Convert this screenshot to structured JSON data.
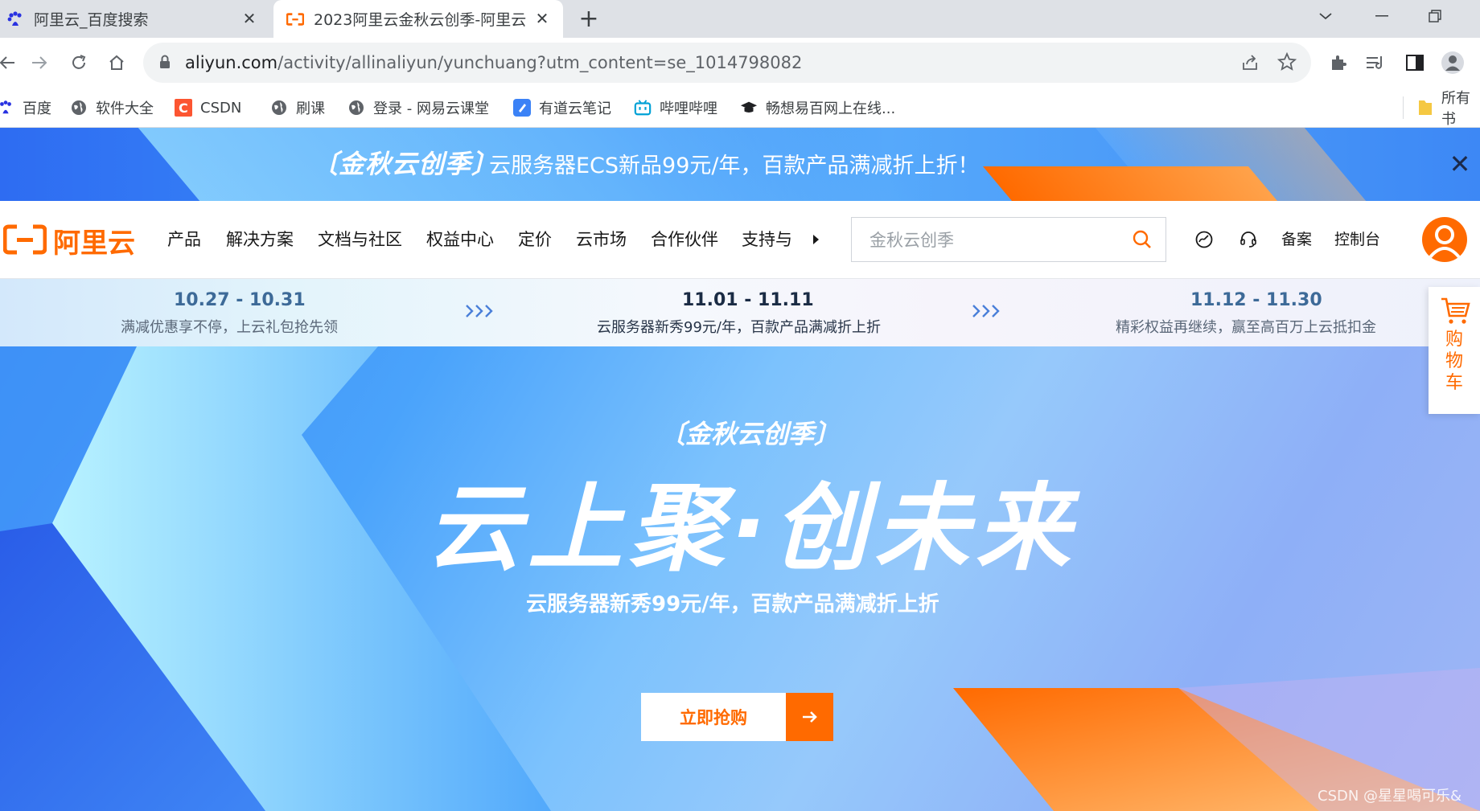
{
  "browser": {
    "tabs": [
      {
        "title": "阿里云_百度搜索",
        "favicon": "baidu-paw-icon",
        "active": false
      },
      {
        "title": "2023阿里云金秋云创季-阿里云",
        "favicon": "aliyun-logo-icon",
        "active": true
      }
    ],
    "new_tab_icon": "plus-icon",
    "window_buttons": [
      "chevron-down-icon",
      "minimize-icon",
      "restore-icon"
    ],
    "url_host": "aliyun.com",
    "url_rest": "/activity/allinaliyun/yunchuang?utm_content=se_1014798082",
    "bookmarks": [
      {
        "label": "百度",
        "icon": "baidu-paw-icon"
      },
      {
        "label": "软件大全",
        "icon": "globe-icon"
      },
      {
        "label": "CSDN",
        "icon": "csdn-icon"
      },
      {
        "label": "刷课",
        "icon": "globe-icon"
      },
      {
        "label": "登录 - 网易云课堂",
        "icon": "globe-icon"
      },
      {
        "label": "有道云笔记",
        "icon": "youdao-note-icon"
      },
      {
        "label": "哔哩哔哩",
        "icon": "bilibili-icon"
      },
      {
        "label": "畅想易百网上在线...",
        "icon": "graduation-cap-icon"
      },
      {
        "label": "所有书",
        "icon": "folder-icon"
      }
    ]
  },
  "promo_bar": {
    "tag": "〔金秋云创季〕",
    "text": "云服务器ECS新品99元/年，百款产品满减折上折！"
  },
  "nav": {
    "logo": "阿里云",
    "items": [
      "产品",
      "解决方案",
      "文档与社区",
      "权益中心",
      "定价",
      "云市场",
      "合作伙伴",
      "支持与"
    ],
    "search_placeholder": "金秋云创季",
    "right_links": [
      "备案",
      "控制台"
    ]
  },
  "timeline": [
    {
      "date": "10.27 - 10.31",
      "desc": "满减优惠享不停，上云礼包抢先领",
      "active": false
    },
    {
      "date": "11.01 - 11.11",
      "desc": "云服务器新秀99元/年，百款产品满减折上折",
      "active": true
    },
    {
      "date": "11.12 - 11.30",
      "desc": "精彩权益再继续，赢至高百万上云抵扣金",
      "active": false
    }
  ],
  "hero": {
    "tag": "〔金秋云创季〕",
    "title": "云上聚·创未来",
    "subtitle": "云服务器新秀99元/年，百款产品满减折上折",
    "cta": "立即抢购"
  },
  "cart": {
    "label": "购物车"
  },
  "watermark": "CSDN @星星喝可乐&",
  "colors": {
    "brand": "#ff6a00",
    "hero_blue": "#4aa3fb"
  }
}
